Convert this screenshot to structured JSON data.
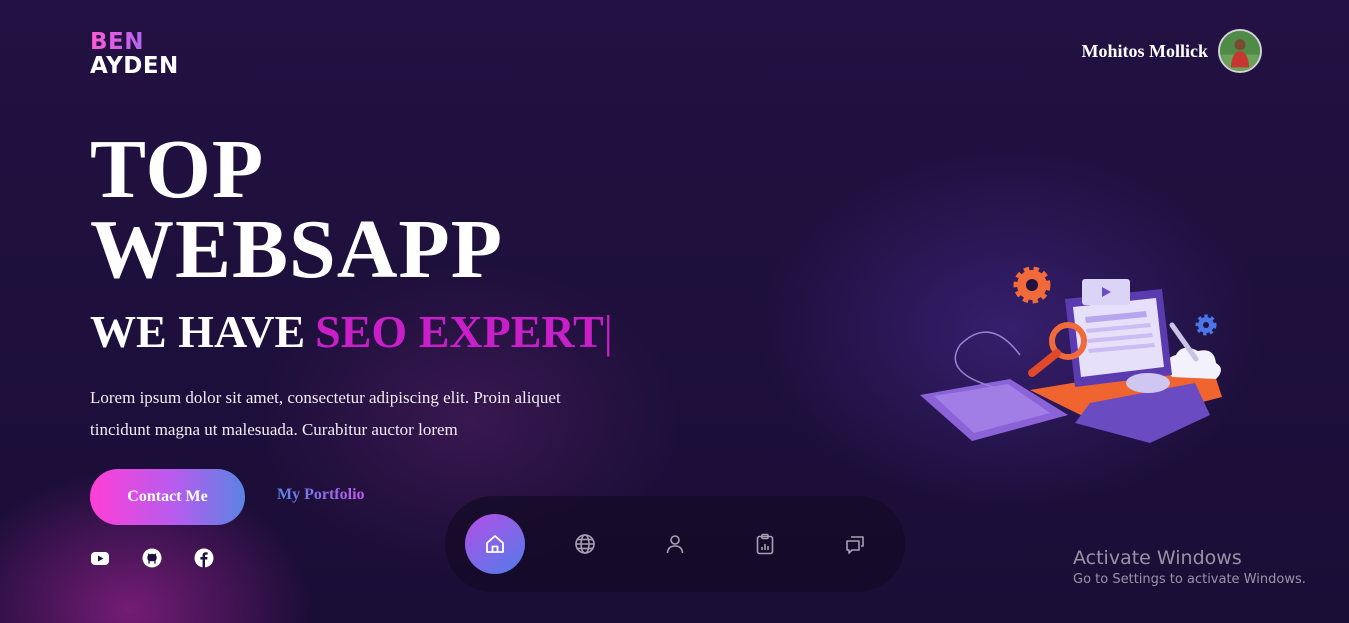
{
  "brand": {
    "line1": "BEN",
    "line2": "AYDEN"
  },
  "user": {
    "name": "Mohitos Mollick"
  },
  "hero": {
    "title_line1": "TOP",
    "title_line2": "WEBSAPP",
    "tagline_fixed": "WE HAVE",
    "tagline_rotating": "SEO EXPERT",
    "tagline_cursor": "|",
    "description": "Lorem ipsum dolor sit amet, consectetur adipiscing elit. Proin aliquet tincidunt magna ut malesuada. Curabitur auctor lorem"
  },
  "actions": {
    "contact_label": "Contact Me",
    "portfolio_label": "My Portfolio"
  },
  "socials": [
    {
      "icon": "youtube-icon"
    },
    {
      "icon": "github-icon"
    },
    {
      "icon": "facebook-icon"
    }
  ],
  "dock": {
    "active": "home",
    "items": [
      {
        "icon": "home-icon"
      },
      {
        "icon": "globe-icon"
      },
      {
        "icon": "user-icon"
      },
      {
        "icon": "clipboard-chart-icon"
      },
      {
        "icon": "chat-icon"
      }
    ]
  },
  "watermark": {
    "title": "Activate Windows",
    "subtitle": "Go to Settings to activate Windows."
  },
  "colors": {
    "accent_pink": "#ff3fd6",
    "accent_blue": "#5a84e3",
    "tagline_magenta": "#c81fc8",
    "background": "#1f0f3d"
  }
}
